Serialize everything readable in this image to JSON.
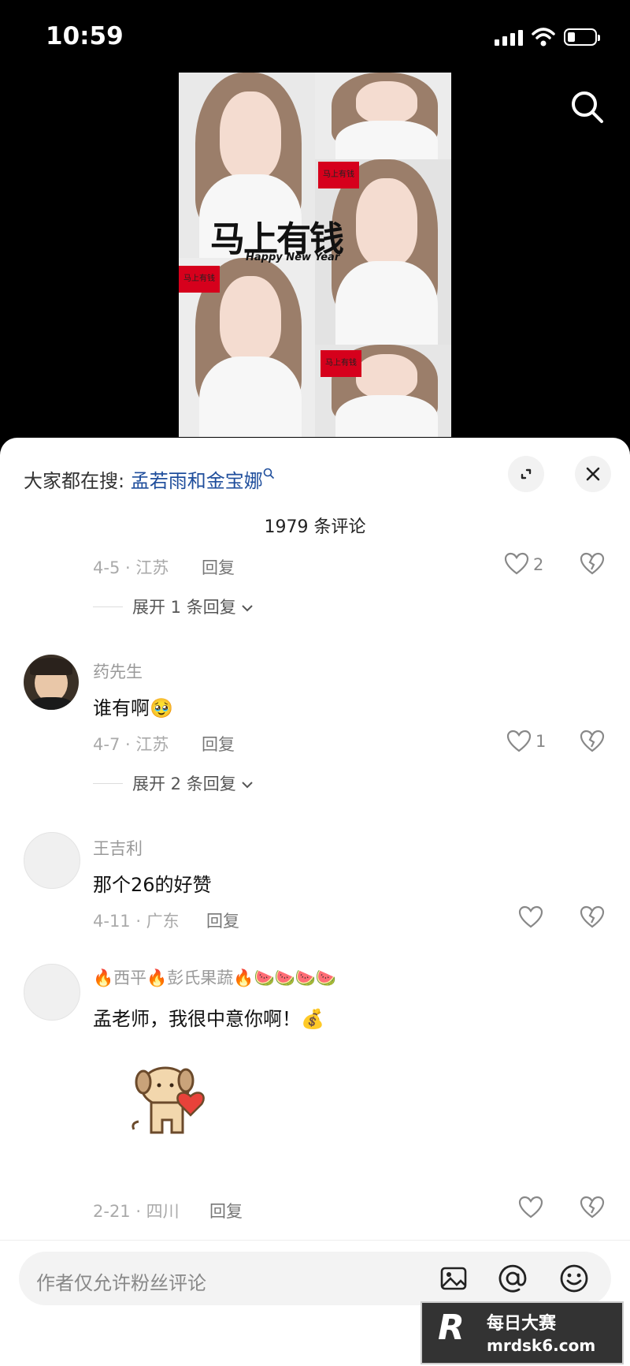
{
  "status": {
    "time": "10:59"
  },
  "video": {
    "sticker_title": "马上有钱",
    "sticker_subtitle": "Happy New Year",
    "tag_text": "马上有钱"
  },
  "sheet": {
    "hot_search_prefix": "大家都在搜:",
    "hot_search_link": "孟若雨和金宝娜",
    "comment_count": "1979 条评论"
  },
  "comments": [
    {
      "meta": "4-5 · 江苏",
      "reply": "回复",
      "likes": "2",
      "expand": "展开 1 条回复"
    },
    {
      "user": "药先生",
      "text": "谁有啊",
      "emoji": "🥹",
      "meta": "4-7 · 江苏",
      "reply": "回复",
      "likes": "1",
      "expand": "展开 2 条回复"
    },
    {
      "user": "王吉利",
      "text": "那个26的好赞",
      "meta": "4-11 · 广东",
      "reply": "回复",
      "likes": ""
    },
    {
      "user": "🔥西平🔥彭氏果蔬🔥🍉🍉🍉🍉",
      "text": "孟老师，我很中意你啊！",
      "emoji": "💰",
      "meta": "2-21 · 四川",
      "reply": "回复",
      "likes": ""
    }
  ],
  "input": {
    "placeholder": "作者仅允许粉丝评论"
  },
  "watermark": {
    "logo": "R",
    "line1": "每日大赛",
    "line2": "mrdsk6.com"
  },
  "icons": [
    "search-icon",
    "collapse-icon",
    "close-icon",
    "heart-icon",
    "broken-heart-icon",
    "chevron-down-icon",
    "image-icon",
    "at-icon",
    "emoji-icon"
  ]
}
